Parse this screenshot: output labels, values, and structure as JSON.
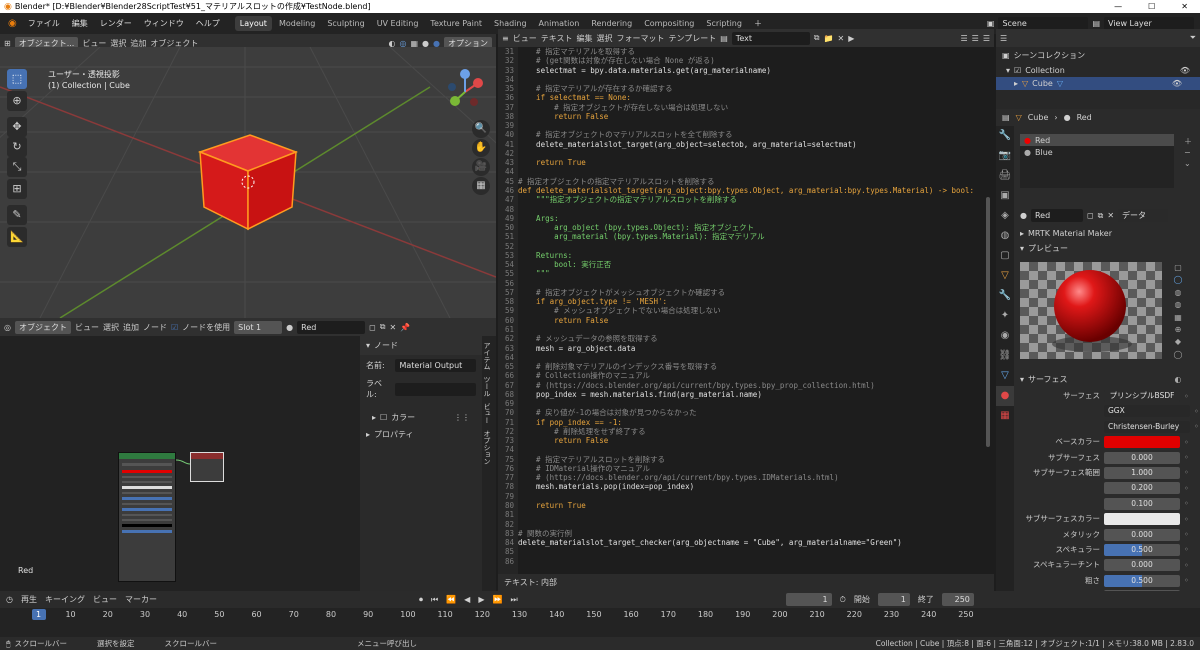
{
  "window_title": "Blender* [D:¥Blender¥Blender28ScriptTest¥51_マテリアルスロットの作成¥TestNode.blend]",
  "menu": [
    "ファイル",
    "編集",
    "レンダー",
    "ウィンドウ",
    "ヘルプ"
  ],
  "workspaces": [
    "Layout",
    "Modeling",
    "Sculpting",
    "UV Editing",
    "Texture Paint",
    "Shading",
    "Animation",
    "Rendering",
    "Compositing",
    "Scripting"
  ],
  "active_workspace": "Layout",
  "scene": "Scene",
  "view_layer": "View Layer",
  "viewport": {
    "mode": "オブジェクト...",
    "menus": [
      "ビュー",
      "選択",
      "追加",
      "オブジェクト"
    ],
    "transform": "グロー...",
    "options": "オプション",
    "view_name": "ユーザー・透視投影",
    "collection_info": "(1) Collection | Cube"
  },
  "node_editor": {
    "mode": "オブジェクト",
    "menus": [
      "ビュー",
      "選択",
      "追加",
      "ノード"
    ],
    "use_nodes": "ノードを使用",
    "slot": "Slot 1",
    "material": "Red",
    "bottom_label": "Red",
    "sidebar": {
      "node_header": "ノード",
      "name_label": "名前:",
      "name_value": "Material Output",
      "label_label": "ラベル:",
      "color": "カラー",
      "properties": "プロパティ"
    },
    "tabs": [
      "アイテム",
      "ツール",
      "ビュー",
      "オプション"
    ]
  },
  "text_editor": {
    "menus": [
      "ビュー",
      "テキスト",
      "編集",
      "選択",
      "フォーマット",
      "テンプレート"
    ],
    "file": "Text",
    "footer": "テキスト: 内部",
    "lines": [
      {
        "n": "31",
        "t": "    # 指定マテリアルを取得する",
        "c": "cm"
      },
      {
        "n": "32",
        "t": "    # (get関数は対象が存在しない場合 None が返る)",
        "c": "cm"
      },
      {
        "n": "33",
        "t": "    selectmat = bpy.data.materials.get(arg_materialname)",
        "c": ""
      },
      {
        "n": "34",
        "t": "",
        "c": ""
      },
      {
        "n": "35",
        "t": "    # 指定マテリアルが存在するか確認する",
        "c": "cm"
      },
      {
        "n": "36",
        "t": "    if selectmat == None:",
        "c": "kw"
      },
      {
        "n": "37",
        "t": "        # 指定オブジェクトが存在しない場合は処理しない",
        "c": "cm"
      },
      {
        "n": "38",
        "t": "        return False",
        "c": "kw"
      },
      {
        "n": "39",
        "t": "",
        "c": ""
      },
      {
        "n": "40",
        "t": "    # 指定オブジェクトのマテリアルスロットを全て削除する",
        "c": "cm"
      },
      {
        "n": "41",
        "t": "    delete_materialslot_target(arg_object=selectob, arg_material=selectmat)",
        "c": ""
      },
      {
        "n": "42",
        "t": "",
        "c": ""
      },
      {
        "n": "43",
        "t": "    return True",
        "c": "kw"
      },
      {
        "n": "44",
        "t": "",
        "c": ""
      },
      {
        "n": "45",
        "t": "# 指定オブジェクトの指定マテリアルスロットを削除する",
        "c": "cm"
      },
      {
        "n": "46",
        "t": "def delete_materialslot_target(arg_object:bpy.types.Object, arg_material:bpy.types.Material) -> bool:",
        "c": "def"
      },
      {
        "n": "47",
        "t": "    \"\"\"指定オブジェクトの指定マテリアルスロットを削除する",
        "c": "st"
      },
      {
        "n": "48",
        "t": "",
        "c": ""
      },
      {
        "n": "49",
        "t": "    Args:",
        "c": "st"
      },
      {
        "n": "50",
        "t": "        arg_object (bpy.types.Object): 指定オブジェクト",
        "c": "st"
      },
      {
        "n": "51",
        "t": "        arg_material (bpy.types.Material): 指定マテリアル",
        "c": "st"
      },
      {
        "n": "52",
        "t": "",
        "c": ""
      },
      {
        "n": "53",
        "t": "    Returns:",
        "c": "st"
      },
      {
        "n": "54",
        "t": "        bool: 実行正否",
        "c": "st"
      },
      {
        "n": "55",
        "t": "    \"\"\"",
        "c": "st"
      },
      {
        "n": "56",
        "t": "",
        "c": ""
      },
      {
        "n": "57",
        "t": "    # 指定オブジェクトがメッシュオブジェクトか確認する",
        "c": "cm"
      },
      {
        "n": "58",
        "t": "    if arg_object.type != 'MESH':",
        "c": "kw"
      },
      {
        "n": "59",
        "t": "        # メッシュオブジェクトでない場合は処理しない",
        "c": "cm"
      },
      {
        "n": "60",
        "t": "        return False",
        "c": "kw"
      },
      {
        "n": "61",
        "t": "",
        "c": ""
      },
      {
        "n": "62",
        "t": "    # メッシュデータの参照を取得する",
        "c": "cm"
      },
      {
        "n": "63",
        "t": "    mesh = arg_object.data",
        "c": ""
      },
      {
        "n": "64",
        "t": "",
        "c": ""
      },
      {
        "n": "65",
        "t": "    # 削除対象マテリアルのインデックス番号を取得する",
        "c": "cm"
      },
      {
        "n": "66",
        "t": "    # Collection操作のマニュアル",
        "c": "cm"
      },
      {
        "n": "67",
        "t": "    # (https://docs.blender.org/api/current/bpy.types.bpy_prop_collection.html)",
        "c": "cm"
      },
      {
        "n": "68",
        "t": "    pop_index = mesh.materials.find(arg_material.name)",
        "c": ""
      },
      {
        "n": "69",
        "t": "",
        "c": ""
      },
      {
        "n": "70",
        "t": "    # 戻り値が-1の場合は対象が見つからなかった",
        "c": "cm"
      },
      {
        "n": "71",
        "t": "    if pop_index == -1:",
        "c": "kw"
      },
      {
        "n": "72",
        "t": "        # 削除処理をせず終了する",
        "c": "cm"
      },
      {
        "n": "73",
        "t": "        return False",
        "c": "kw"
      },
      {
        "n": "74",
        "t": "",
        "c": ""
      },
      {
        "n": "75",
        "t": "    # 指定マテリアルスロットを削除する",
        "c": "cm"
      },
      {
        "n": "76",
        "t": "    # IDMaterial操作のマニュアル",
        "c": "cm"
      },
      {
        "n": "77",
        "t": "    # (https://docs.blender.org/api/current/bpy.types.IDMaterials.html)",
        "c": "cm"
      },
      {
        "n": "78",
        "t": "    mesh.materials.pop(index=pop_index)",
        "c": ""
      },
      {
        "n": "79",
        "t": "",
        "c": ""
      },
      {
        "n": "80",
        "t": "    return True",
        "c": "kw"
      },
      {
        "n": "81",
        "t": "",
        "c": ""
      },
      {
        "n": "82",
        "t": "",
        "c": ""
      },
      {
        "n": "83",
        "t": "# 関数の実行例",
        "c": "cm"
      },
      {
        "n": "84",
        "t": "delete_materialslot_target_checker(arg_objectname = \"Cube\", arg_materialname=\"Green\")",
        "c": "call"
      },
      {
        "n": "85",
        "t": "",
        "c": ""
      },
      {
        "n": "86",
        "t": "",
        "c": ""
      }
    ]
  },
  "outliner": {
    "scene_collection": "シーンコレクション",
    "collection": "Collection",
    "cube": "Cube"
  },
  "properties": {
    "breadcrumb_object": "Cube",
    "breadcrumb_material": "Red",
    "slots": [
      "Red",
      "Blue"
    ],
    "material_name": "Red",
    "data_label": "データ",
    "mrtk": "MRTK Material Maker",
    "preview": "プレビュー",
    "surface": "サーフェス",
    "fields": [
      {
        "label": "サーフェス",
        "value": "プリンシプルBSDF",
        "type": "text"
      },
      {
        "label": "",
        "value": "GGX",
        "type": "drop"
      },
      {
        "label": "",
        "value": "Christensen-Burley",
        "type": "drop"
      },
      {
        "label": "ベースカラー",
        "value": "",
        "type": "color",
        "color": "#e00000"
      },
      {
        "label": "サブサーフェス",
        "value": "0.000",
        "type": "num"
      },
      {
        "label": "サブサーフェス範囲",
        "value": "1.000",
        "type": "num"
      },
      {
        "label": "",
        "value": "0.200",
        "type": "num"
      },
      {
        "label": "",
        "value": "0.100",
        "type": "num"
      },
      {
        "label": "サブサーフェスカラー",
        "value": "",
        "type": "color",
        "color": "#e8e8e8"
      },
      {
        "label": "メタリック",
        "value": "0.000",
        "type": "num"
      },
      {
        "label": "スペキュラー",
        "value": "0.500",
        "type": "slider",
        "fill": 0.5
      },
      {
        "label": "スペキュラーチント",
        "value": "0.000",
        "type": "num"
      },
      {
        "label": "粗さ",
        "value": "0.500",
        "type": "slider",
        "fill": 0.5
      },
      {
        "label": "異方性",
        "value": "0.000",
        "type": "num"
      },
      {
        "label": "異方性の回転",
        "value": "0.000",
        "type": "num"
      },
      {
        "label": "シーン",
        "value": "0.000",
        "type": "num"
      }
    ]
  },
  "timeline": {
    "menus": [
      "再生",
      "キーイング",
      "ビュー",
      "マーカー"
    ],
    "current": "1",
    "start_label": "開始",
    "start": "1",
    "end_label": "終了",
    "end": "250",
    "ticks": [
      "1",
      "10",
      "20",
      "30",
      "40",
      "50",
      "60",
      "70",
      "80",
      "90",
      "100",
      "110",
      "120",
      "130",
      "140",
      "150",
      "160",
      "170",
      "180",
      "190",
      "200",
      "210",
      "220",
      "230",
      "240",
      "250"
    ]
  },
  "status": {
    "left": [
      "スクロールバー",
      "選択を設定",
      "スクロールバー",
      "メニュー呼び出し"
    ],
    "right": "Collection | Cube | 頂点:8 | 面:6 | 三角面:12 | オブジェクト:1/1 | メモリ:38.0 MB | 2.83.0"
  }
}
